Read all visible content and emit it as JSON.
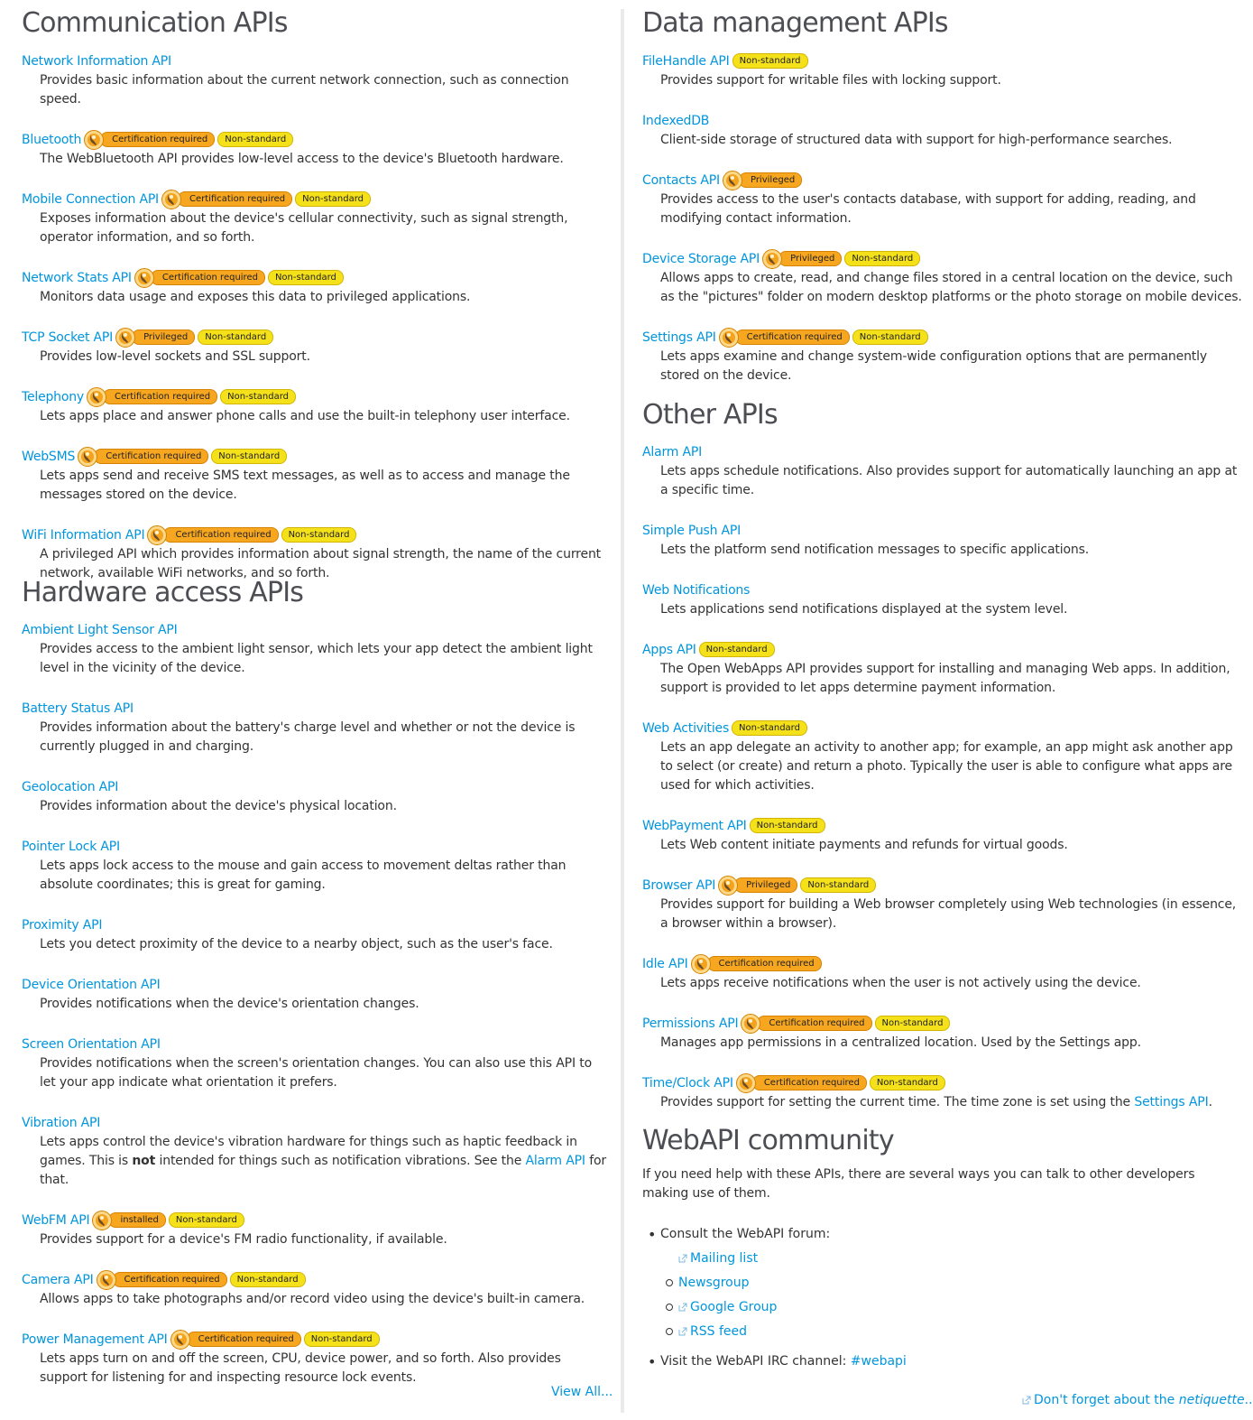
{
  "badges": {
    "cert": "Certification required",
    "ns": "Non-standard",
    "priv": "Privileged",
    "inst": "installed"
  },
  "left": {
    "communication": {
      "heading": "Communication APIs",
      "items": [
        {
          "name": "Network Information API",
          "badges": [],
          "desc": "Provides basic information about the current network connection, such as connection speed."
        },
        {
          "name": "Bluetooth",
          "badges": [
            "cert",
            "ns"
          ],
          "desc": "The WebBluetooth API provides low-level access to the device's Bluetooth hardware."
        },
        {
          "name": "Mobile Connection API",
          "badges": [
            "cert",
            "ns"
          ],
          "desc": "Exposes information about the device's cellular connectivity, such as signal strength, operator information, and so forth."
        },
        {
          "name": "Network Stats API",
          "badges": [
            "cert",
            "ns"
          ],
          "desc": "Monitors data usage and exposes this data to privileged applications."
        },
        {
          "name": "TCP Socket API",
          "badges": [
            "priv",
            "ns"
          ],
          "desc": "Provides low-level sockets and SSL support."
        },
        {
          "name": "Telephony",
          "badges": [
            "cert",
            "ns"
          ],
          "desc": "Lets apps place and answer phone calls and use the built-in telephony user interface."
        },
        {
          "name": "WebSMS",
          "badges": [
            "cert",
            "ns"
          ],
          "desc": "Lets apps send and receive SMS text messages, as well as to access and manage the messages stored on the device."
        },
        {
          "name": "WiFi Information API",
          "badges": [
            "cert",
            "ns"
          ],
          "desc": "A privileged API which provides information about signal strength, the name of the current network, available WiFi networks, and so forth."
        }
      ]
    },
    "hardware": {
      "heading": "Hardware access APIs",
      "items": [
        {
          "name": "Ambient Light Sensor API",
          "badges": [],
          "desc": "Provides access to the ambient light sensor, which lets your app detect the ambient light level in the vicinity of the device."
        },
        {
          "name": "Battery Status API",
          "badges": [],
          "desc": "Provides information about the battery's charge level and whether or not the device is currently plugged in and charging."
        },
        {
          "name": "Geolocation API",
          "badges": [],
          "desc": "Provides information about the device's physical location."
        },
        {
          "name": "Pointer Lock API",
          "badges": [],
          "desc": "Lets apps lock access to the mouse and gain access to movement deltas rather than absolute coordinates; this is great for gaming."
        },
        {
          "name": "Proximity API",
          "badges": [],
          "desc": "Lets you detect proximity of the device to a nearby object, such as the user's face."
        },
        {
          "name": "Device Orientation API",
          "badges": [],
          "desc": "Provides notifications when the device's orientation changes."
        },
        {
          "name": "Screen Orientation API",
          "badges": [],
          "desc": "Provides notifications when the screen's orientation changes. You can also use this API to let your app indicate what orientation it prefers."
        },
        {
          "name": "Vibration API",
          "badges": [],
          "desc_parts": [
            "Lets apps control the device's vibration hardware for things such as haptic feedback in games. This is ",
            "not",
            " intended for things such as notification vibrations. See the ",
            "Alarm API",
            " for that."
          ]
        },
        {
          "name": "WebFM API",
          "badges": [
            "inst",
            "ns"
          ],
          "desc": "Provides support for a device's FM radio functionality, if available."
        },
        {
          "name": "Camera API",
          "badges": [
            "cert",
            "ns"
          ],
          "desc": "Allows apps to take photographs and/or record video using the device's built-in camera."
        },
        {
          "name": "Power Management API",
          "badges": [
            "cert",
            "ns"
          ],
          "desc": "Lets apps turn on and off the screen, CPU, device power, and so forth. Also provides support for listening for and inspecting resource lock events."
        }
      ]
    },
    "view_all": "View All..."
  },
  "right": {
    "data": {
      "heading": "Data management APIs",
      "items": [
        {
          "name": "FileHandle API",
          "badges": [
            "ns"
          ],
          "desc": "Provides support for writable files with locking support."
        },
        {
          "name": "IndexedDB",
          "badges": [],
          "desc": "Client-side storage of structured data with support for high-performance searches."
        },
        {
          "name": "Contacts API",
          "badges": [
            "priv"
          ],
          "desc": "Provides access to the user's contacts database, with support for adding, reading, and modifying contact information."
        },
        {
          "name": "Device Storage API",
          "badges": [
            "priv",
            "ns"
          ],
          "desc": "Allows apps to create, read, and change files stored in a central location on the device, such as the \"pictures\" folder on modern desktop platforms or the photo storage on mobile devices."
        },
        {
          "name": "Settings API",
          "badges": [
            "cert",
            "ns"
          ],
          "desc": "Lets apps examine and change system-wide configuration options that are permanently stored on the device."
        }
      ]
    },
    "other": {
      "heading": "Other APIs",
      "items": [
        {
          "name": "Alarm API",
          "badges": [],
          "desc": "Lets apps schedule notifications. Also provides support for automatically launching an app at a specific time."
        },
        {
          "name": "Simple Push API",
          "badges": [],
          "desc": "Lets the platform send notification messages to specific applications."
        },
        {
          "name": "Web Notifications",
          "badges": [],
          "desc": "Lets applications send notifications displayed at the system level."
        },
        {
          "name": "Apps API",
          "badges": [
            "ns"
          ],
          "desc": "The Open WebApps API provides support for installing and managing Web apps. In addition, support is provided to let apps determine payment information."
        },
        {
          "name": "Web Activities",
          "badges": [
            "ns"
          ],
          "desc": "Lets an app delegate an activity to another app; for example, an app might ask another app to select (or create) and return a photo. Typically the user is able to configure what apps are used for which activities."
        },
        {
          "name": "WebPayment API",
          "badges": [
            "ns"
          ],
          "desc": "Lets Web content initiate payments and refunds for virtual goods."
        },
        {
          "name": "Browser API",
          "badges": [
            "priv",
            "ns"
          ],
          "desc": "Provides support for building a Web browser completely using Web technologies (in essence, a browser within a browser)."
        },
        {
          "name": "Idle API",
          "badges": [
            "cert"
          ],
          "desc": "Lets apps receive notifications when the user is not actively using the device."
        },
        {
          "name": "Permissions API",
          "badges": [
            "cert",
            "ns"
          ],
          "desc": "Manages app permissions in a centralized location. Used by the Settings app."
        },
        {
          "name": "Time/Clock API",
          "badges": [
            "cert",
            "ns"
          ],
          "desc_parts": [
            "Provides support for setting the current time. The time zone is set using the ",
            "Settings API",
            "."
          ]
        }
      ]
    },
    "community": {
      "heading": "WebAPI community",
      "intro": "If you need help with these APIs, there are several ways you can talk to other developers making use of them.",
      "forum_label": "Consult the WebAPI forum:",
      "mailing_list": "Mailing list",
      "newsgroup": "Newsgroup",
      "google_group": "Google Group",
      "rss_feed": "RSS feed",
      "irc_label": "Visit the WebAPI IRC channel: ",
      "irc_channel": "#webapi",
      "netiquette_prefix": "Don't forget about the ",
      "netiquette_em": "netiquette",
      "netiquette_suffix": "..."
    }
  }
}
